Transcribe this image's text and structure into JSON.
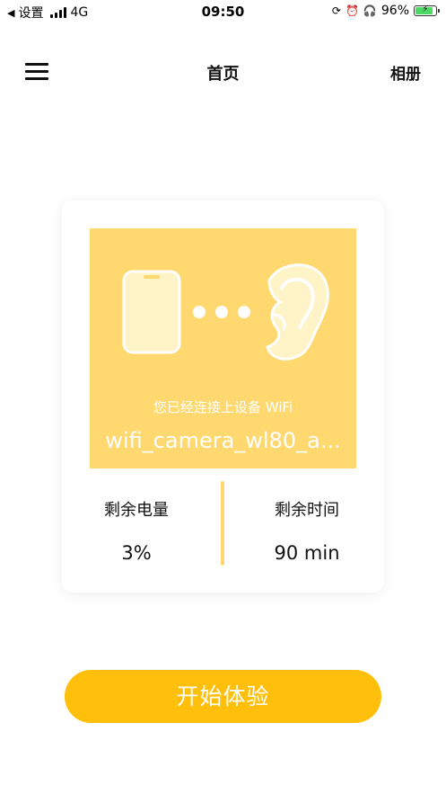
{
  "status_bar": {
    "back_label": "设置",
    "network": "4G",
    "time": "09:50",
    "battery_percent": "96%",
    "battery_level": 0.96
  },
  "nav": {
    "title": "首页",
    "right_label": "相册"
  },
  "card": {
    "connect_message": "您已经连接上设备 WiFi",
    "ssid": "wifi_camera_wl80_a...",
    "battery": {
      "label": "剩余电量",
      "value": "3%"
    },
    "time_left": {
      "label": "剩余时间",
      "value": "90 min"
    }
  },
  "cta": {
    "label": "开始体验"
  },
  "colors": {
    "accent": "#ffbf0a",
    "hero_bg": "#ffd86f",
    "hero_light": "#fff3c8"
  }
}
